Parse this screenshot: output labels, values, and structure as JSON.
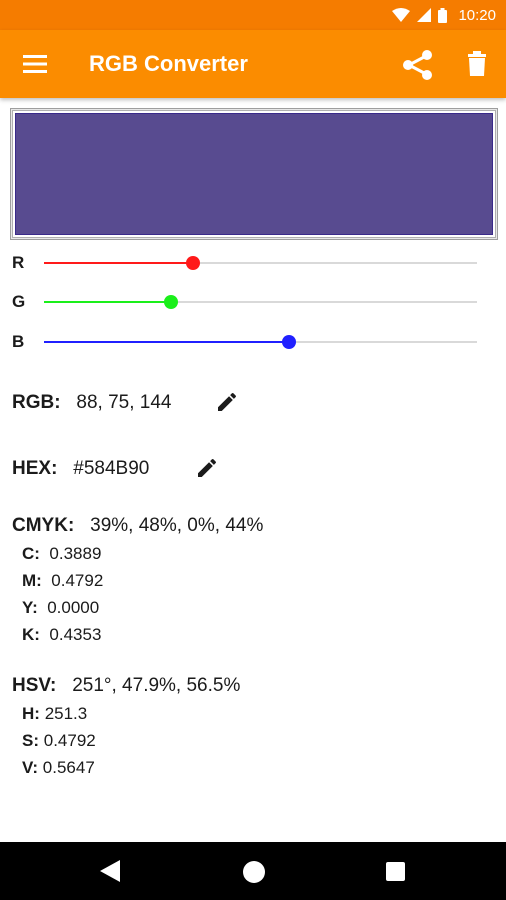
{
  "status_bar": {
    "time": "10:20"
  },
  "app_bar": {
    "title": "RGB Converter"
  },
  "colors": {
    "primary": "#fb8c00",
    "primary_dark": "#f57c00",
    "preview": "#584B90",
    "red_slider": "#ff1a1a",
    "green_slider": "#1aef1a",
    "blue_slider": "#2020ff"
  },
  "sliders": [
    {
      "label": "R",
      "value": 88,
      "max": 255
    },
    {
      "label": "G",
      "value": 75,
      "max": 255
    },
    {
      "label": "B",
      "value": 144,
      "max": 255
    }
  ],
  "rgb": {
    "label": "RGB:",
    "value": "88, 75, 144"
  },
  "hex": {
    "label": "HEX:",
    "value": "#584B90"
  },
  "cmyk": {
    "label": "CMYK:",
    "summary": "39%, 48%, 0%, 44%",
    "items": [
      {
        "label": "C:",
        "value": "0.3889"
      },
      {
        "label": "M:",
        "value": "0.4792"
      },
      {
        "label": "Y:",
        "value": "0.0000"
      },
      {
        "label": "K:",
        "value": "0.4353"
      }
    ]
  },
  "hsv": {
    "label": "HSV:",
    "summary": "251°, 47.9%, 56.5%",
    "items": [
      {
        "label": "H:",
        "value": "251.3"
      },
      {
        "label": "S:",
        "value": "0.4792"
      },
      {
        "label": "V:",
        "value": "0.5647"
      }
    ]
  },
  "icons": {
    "menu": "menu-icon",
    "share": "share-icon",
    "delete": "trash-icon",
    "edit": "pencil-icon",
    "nav_back": "back-triangle-icon",
    "nav_home": "home-circle-icon",
    "nav_recent": "recents-square-icon"
  }
}
